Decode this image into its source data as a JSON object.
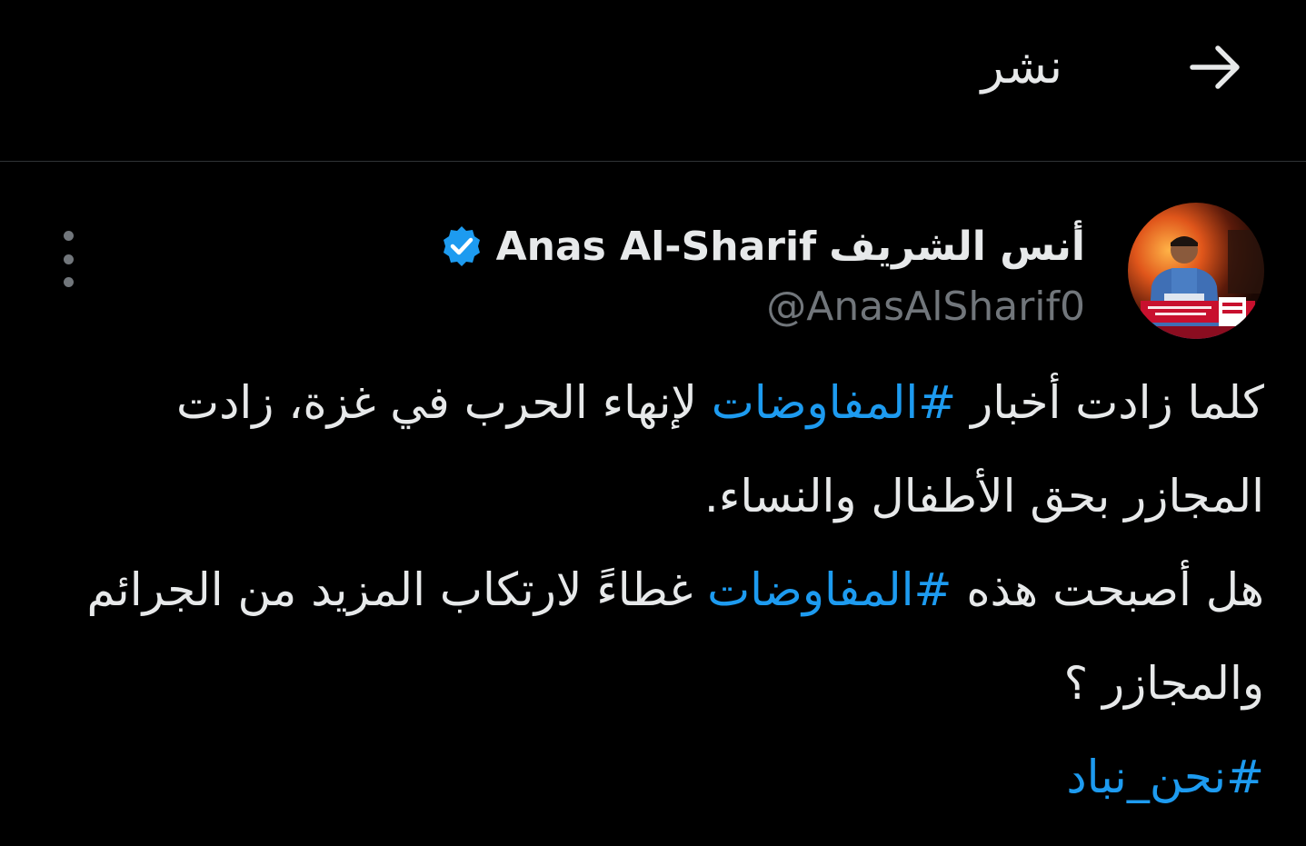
{
  "header": {
    "title": "نشر",
    "back_icon": "arrow-right-icon"
  },
  "tweet": {
    "author": {
      "display_name_ar": "أنس الشريف",
      "display_name_en": "Anas Al-Sharif",
      "handle": "@AnasAlSharif0",
      "verified_icon": "verified-badge-icon",
      "verified_color": "#1d9bf0"
    },
    "more_icon": "more-vertical-icon",
    "body": {
      "line1_before": "كلما زادت أخبار ",
      "hashtag1": "#المفاوضات",
      "line1_after": " لإنهاء الحرب في غزة، زادت المجازر بحق الأطفال والنساء.",
      "line2_before": "هل أصبحت هذه ",
      "hashtag2": "#المفاوضات",
      "line2_after": " غطاءً لارتكاب المزيد من الجرائم والمجازر ؟",
      "hashtag3": "#نحن_نباد"
    }
  },
  "colors": {
    "background": "#000000",
    "text": "#e7e9ea",
    "muted": "#71767b",
    "accent": "#1d9bf0",
    "divider": "#2f3336"
  }
}
